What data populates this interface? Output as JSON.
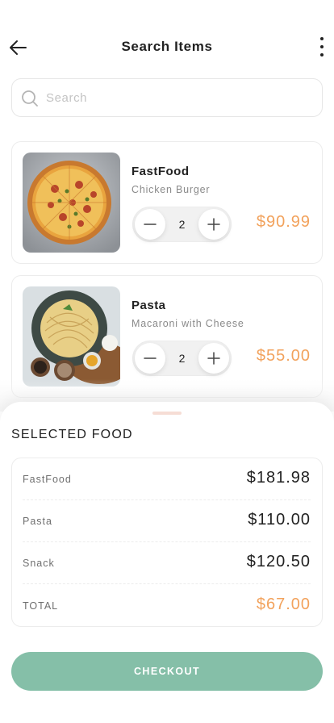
{
  "header": {
    "title": "Search Items"
  },
  "search": {
    "placeholder": "Search",
    "value": ""
  },
  "items": [
    {
      "name": "FastFood",
      "description": "Chicken Burger",
      "quantity": "2",
      "price": "$90.99",
      "image": "pizza-image"
    },
    {
      "name": "Pasta",
      "description": "Macaroni with Cheese",
      "quantity": "2",
      "price": "$55.00",
      "image": "spaghetti-image"
    }
  ],
  "selected": {
    "title": "SELECTED FOOD",
    "rows": [
      {
        "label": "FastFood",
        "value": "$181.98"
      },
      {
        "label": "Pasta",
        "value": "$110.00"
      },
      {
        "label": "Snack",
        "value": "$120.50"
      },
      {
        "label": "TOTAL",
        "value": "$67.00"
      }
    ]
  },
  "checkout": {
    "label": "CHECKOUT"
  },
  "colors": {
    "accent": "#f2a25c",
    "button": "#85bfa8"
  }
}
